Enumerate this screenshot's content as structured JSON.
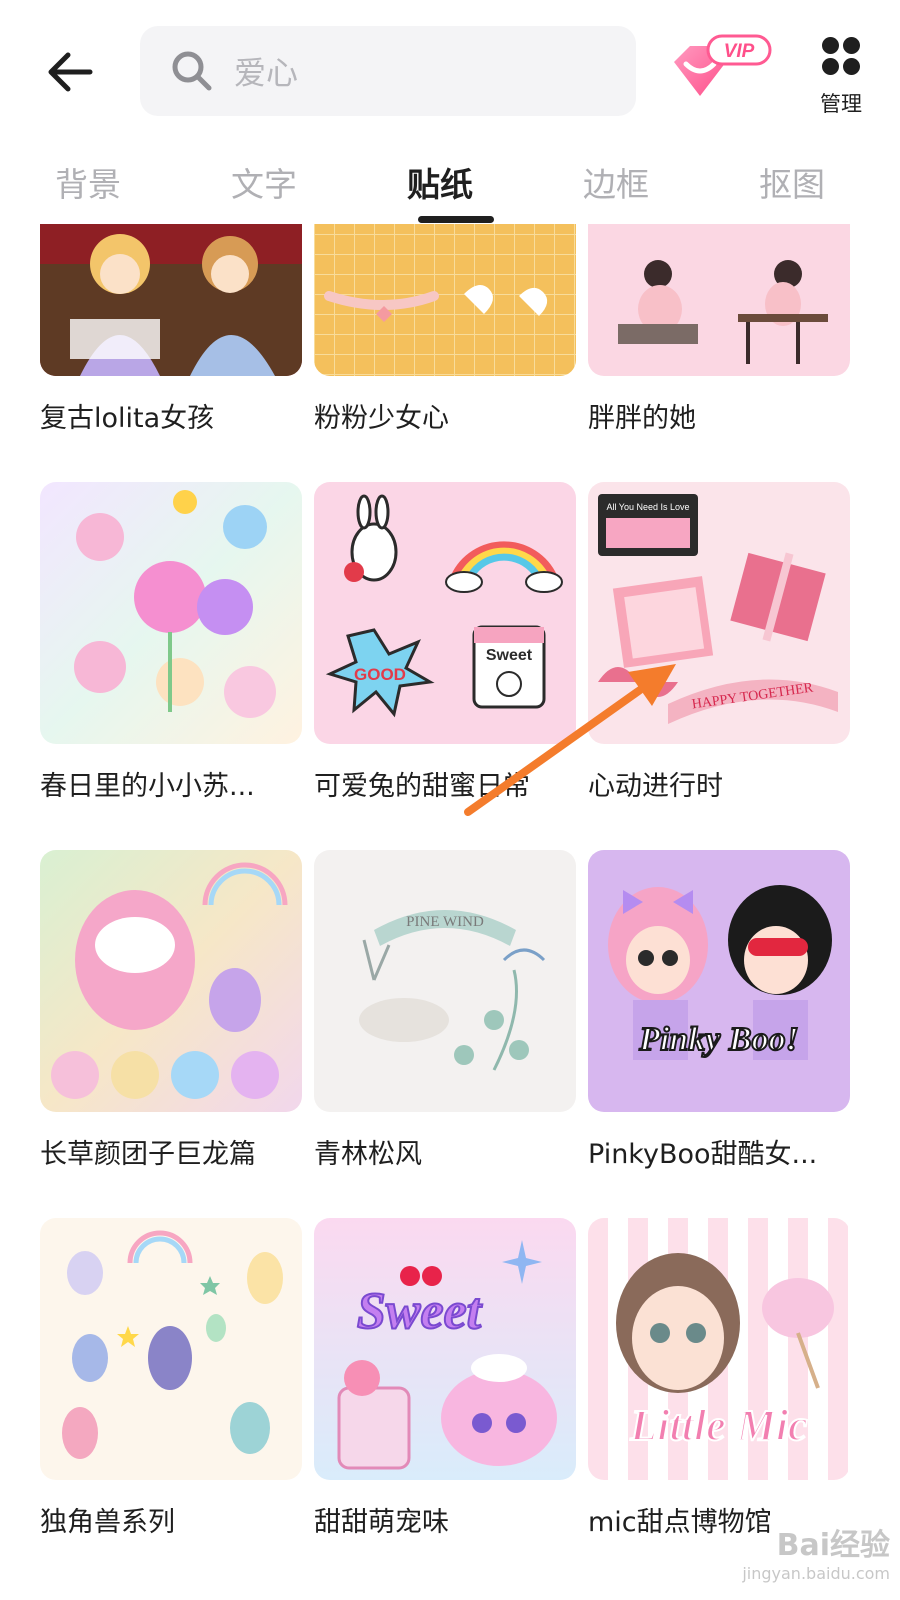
{
  "search": {
    "placeholder": "爱心"
  },
  "vip": {
    "badge": "VIP"
  },
  "manage": {
    "label": "管理"
  },
  "tabs": [
    {
      "label": "背景"
    },
    {
      "label": "文字"
    },
    {
      "label": "贴纸"
    },
    {
      "label": "边框"
    },
    {
      "label": "抠图"
    }
  ],
  "stickers": [
    {
      "title": "复古lolita女孩"
    },
    {
      "title": "粉粉少女心"
    },
    {
      "title": "胖胖的她"
    },
    {
      "title": "春日里的小小苏..."
    },
    {
      "title": "可爱兔的甜蜜日常"
    },
    {
      "title": "心动进行时"
    },
    {
      "title": "长草颜团子巨龙篇"
    },
    {
      "title": "青林松风"
    },
    {
      "title": "PinkyBoo甜酷女..."
    },
    {
      "title": "独角兽系列"
    },
    {
      "title": "甜甜萌宠味"
    },
    {
      "title": "mic甜点博物馆"
    }
  ],
  "art_text": {
    "good": "GOOD",
    "sweet": "Sweet",
    "happy_together": "HAPPY TOGETHER",
    "all_you_need": "All You Need Is Love",
    "pine_wind": "PINE WIND",
    "pinky_boo": "Pinky Boo!",
    "sweet_script": "Sweet",
    "little_mic": "Little Mic"
  },
  "watermark": {
    "text": "Bai经验",
    "url": "jingyan.baidu.com"
  },
  "colors": {
    "accent_vip": "#ff6f9c",
    "active_tab": "#1f1f1f",
    "inactive_tab": "#b0b0b4",
    "annotation_arrow": "#f47c2c"
  }
}
